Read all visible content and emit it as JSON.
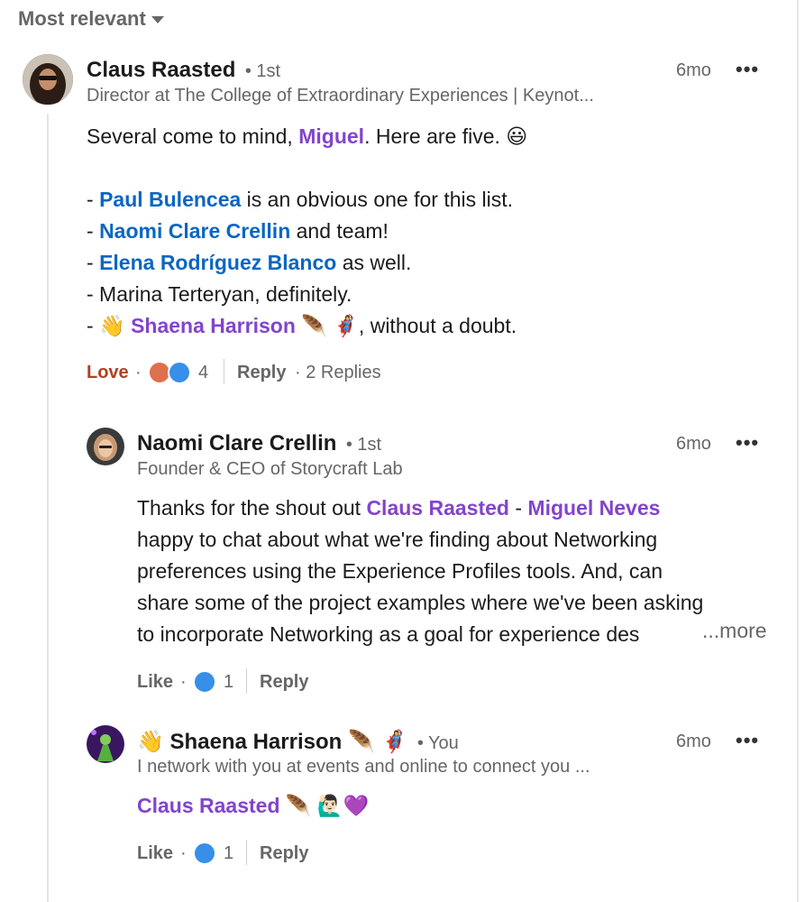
{
  "sort": {
    "label": "Most relevant"
  },
  "comments": [
    {
      "author": "Claus Raasted",
      "degree": "• 1st",
      "headline": "Director at The College of Extraordinary Experiences | Keynot...",
      "time": "6mo",
      "more_icon": "more-options-icon",
      "body": {
        "line1_prefix": "Several come to mind, ",
        "line1_mention": "Miguel",
        "line1_suffix": ". Here are five. 😃",
        "items": [
          {
            "prefix": "- ",
            "mention": "Paul Bulencea",
            "suffix": " is an obvious one for this list."
          },
          {
            "prefix": "- ",
            "mention": "Naomi Clare Crellin",
            "suffix": " and team!"
          },
          {
            "prefix": "- ",
            "mention": "Elena Rodríguez Blanco",
            "suffix": " as well."
          },
          {
            "prefix": "- Marina Terteryan, definitely.",
            "mention": "",
            "suffix": ""
          },
          {
            "prefix": "- 👋 ",
            "mention": "Shaena Harrison",
            "suffix": " 🪶 🦸‍♀️, without a doubt."
          }
        ]
      },
      "actions": {
        "reaction": "Love",
        "dot": "·",
        "count": "4",
        "reply": "Reply",
        "replies": "· 2 Replies"
      }
    },
    {
      "author": "Naomi Clare Crellin",
      "degree": "• 1st",
      "headline": "Founder & CEO of Storycraft Lab",
      "time": "6mo",
      "body": {
        "prefix": "Thanks for the shout out ",
        "mention1": "Claus Raasted",
        "mid": " - ",
        "mention2": "Miguel Neves",
        "lines": [
          " happy to chat about what we're finding about Networking",
          "preferences using the Experience Profiles tools. And, can",
          "share some of the project examples where we've been asking",
          "to incorporate Networking as a goal for experience des"
        ],
        "more": "...more"
      },
      "actions": {
        "reaction": "Like",
        "dot": "·",
        "count": "1",
        "reply": "Reply"
      }
    },
    {
      "author": "👋 Shaena Harrison 🪶 🦸‍♀️",
      "degree": "• You",
      "headline": "I network with you at events and online to connect you ...",
      "time": "6mo",
      "body": {
        "mention": "Claus Raasted",
        "suffix": " 🪶 🙋🏻‍♂️💜"
      },
      "actions": {
        "reaction": "Like",
        "dot": "·",
        "count": "1",
        "reply": "Reply"
      }
    }
  ],
  "colors": {
    "mention_blue": "#0a66c2",
    "mention_purple": "#8344cc",
    "love": "#b24020",
    "like": "#378fe9"
  }
}
